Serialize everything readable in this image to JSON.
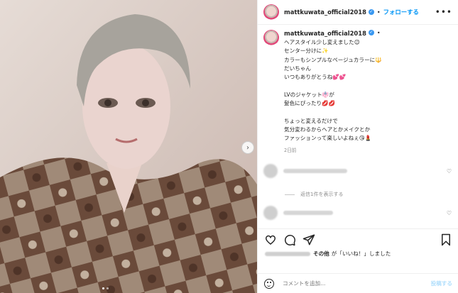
{
  "post": {
    "username": "mattkuwata_official2018",
    "separator": "•",
    "follow_label": "フォローする",
    "more_label": "•••",
    "caption_ellipsis": "•",
    "caption": "ヘアスタイル少し変えました😉\nセンター分けに✨\nカラーもシンプルなベージュカラーに🔱\nだいちゃん\nいつもありがとうね💕💕\n\nLVのジャケット👘が\n髪色にぴったり💋💋\n\nちょっと変えるだけで\n気分変わるからヘアとかメイクとか\nファッションって楽しいよねぇ😘💄",
    "timestamp": "2日前",
    "view_replies": "返信1件を表示する",
    "likes_suffix_bold": "その他",
    "likes_suffix": "が「いいね！」しました",
    "comment_placeholder": "コメントを追加...",
    "post_button": "投稿する"
  },
  "icons": {
    "heart": "heart-icon",
    "comment": "comment-icon",
    "share": "paper-plane-icon",
    "save": "bookmark-icon",
    "emoji": "emoji-icon",
    "next": "chevron-right-icon"
  },
  "colors": {
    "accent": "#0095f6",
    "verified": "#3897f0",
    "post_disabled": "#b2dffc"
  }
}
